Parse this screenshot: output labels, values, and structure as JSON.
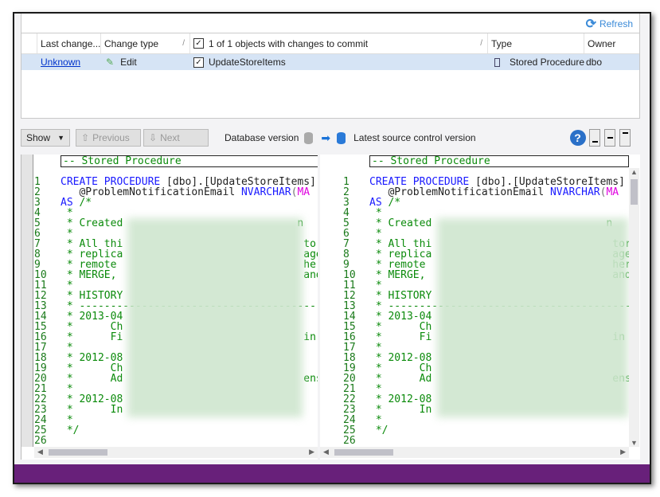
{
  "refresh_label": "Refresh",
  "grid": {
    "headers": [
      "Last change...",
      "Change type",
      "1 of 1 objects with changes to commit",
      "Type",
      "Owner"
    ],
    "rows": [
      {
        "last_change": "Unknown",
        "change_type": "Edit",
        "name": "UpdateStoreItems",
        "checked": true,
        "type": "Stored Procedure",
        "owner": "dbo"
      }
    ]
  },
  "toolbar": {
    "show": "Show",
    "previous": "Previous",
    "next": "Next",
    "db_version": "Database version",
    "source_version": "Latest source control version",
    "help": "?"
  },
  "diff": {
    "header": "-- Stored Procedure",
    "line1": {
      "kw": "CREATE PROCEDURE",
      "rest": " [dbo].[UpdateStoreItems]"
    },
    "line2": {
      "param": "   @ProblemNotificationEmail ",
      "type": "NVARCHAR",
      "paren": "(",
      "val": "MA"
    },
    "line3": {
      "kw": "AS",
      "cm": " /*"
    },
    "comment_lines": [
      " *",
      " * Created                            n",
      " *",
      " * All thi                             tor",
      " * replica                             age",
      " * remote                              her",
      " * MERGE,                              and",
      " *",
      " * HISTORY",
      " * ---------------------------------------",
      " * 2013-04",
      " *      Ch",
      " *      Fi                             in",
      " *",
      " * 2012-08",
      " *      Ch",
      " *      Ad                             ens",
      " *",
      " * 2012-08",
      " *      In",
      " *",
      " */",
      ""
    ]
  },
  "colors": {
    "status_bar": "#68207a",
    "selection": "#d6e4f5",
    "accent": "#3a8ad8"
  }
}
